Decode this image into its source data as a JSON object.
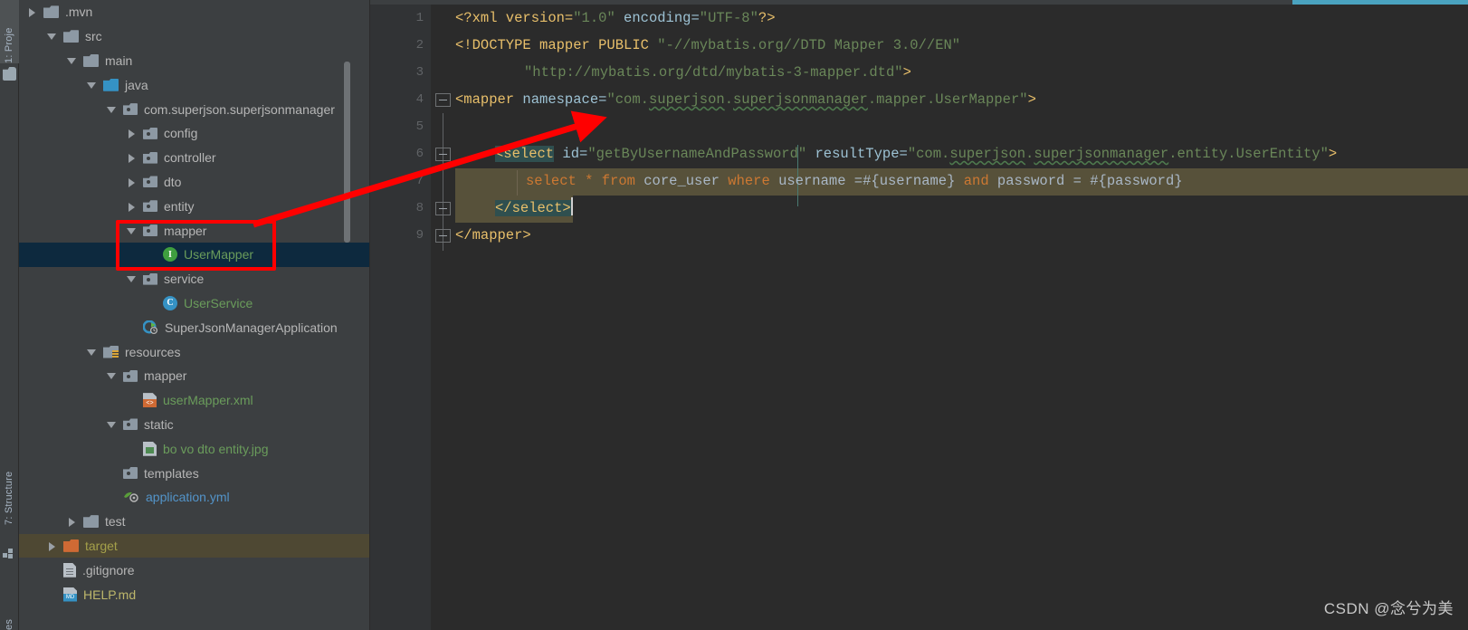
{
  "tool_strip": {
    "project_label": "1: Proje",
    "structure_label": "7: Structure",
    "favorites_label": "es",
    "folder_icon": "folder-icon",
    "grid_icon": "grid-icon"
  },
  "sidebar": {
    "items": [
      {
        "indent": 0,
        "twisty": "right",
        "icon": "folder",
        "label": ".mvn",
        "color": "c-grey",
        "row": ""
      },
      {
        "indent": 1,
        "twisty": "down",
        "icon": "folder",
        "label": "src",
        "color": "c-grey",
        "row": ""
      },
      {
        "indent": 2,
        "twisty": "down",
        "icon": "folder",
        "label": "main",
        "color": "c-grey",
        "row": ""
      },
      {
        "indent": 3,
        "twisty": "down",
        "icon": "folder-src",
        "label": "java",
        "color": "c-grey",
        "row": ""
      },
      {
        "indent": 4,
        "twisty": "down",
        "icon": "pkg",
        "label": "com.superjson.superjsonmanager",
        "color": "c-grey",
        "row": ""
      },
      {
        "indent": 5,
        "twisty": "right",
        "icon": "pkg",
        "label": "config",
        "color": "c-grey",
        "row": ""
      },
      {
        "indent": 5,
        "twisty": "right",
        "icon": "pkg",
        "label": "controller",
        "color": "c-grey",
        "row": ""
      },
      {
        "indent": 5,
        "twisty": "right",
        "icon": "pkg",
        "label": "dto",
        "color": "c-grey",
        "row": ""
      },
      {
        "indent": 5,
        "twisty": "right",
        "icon": "pkg",
        "label": "entity",
        "color": "c-grey",
        "row": ""
      },
      {
        "indent": 5,
        "twisty": "down",
        "icon": "pkg",
        "label": "mapper",
        "color": "c-grey",
        "row": ""
      },
      {
        "indent": 6,
        "twisty": "none",
        "icon": "iface",
        "label": "UserMapper",
        "color": "c-green",
        "row": "sel-blue"
      },
      {
        "indent": 5,
        "twisty": "down",
        "icon": "pkg",
        "label": "service",
        "color": "c-grey",
        "row": ""
      },
      {
        "indent": 6,
        "twisty": "none",
        "icon": "class",
        "label": "UserService",
        "color": "c-green",
        "row": ""
      },
      {
        "indent": 5,
        "twisty": "none",
        "icon": "spring",
        "label": "SuperJsonManagerApplication",
        "color": "c-grey",
        "row": ""
      },
      {
        "indent": 3,
        "twisty": "down",
        "icon": "res",
        "label": "resources",
        "color": "c-grey",
        "row": ""
      },
      {
        "indent": 4,
        "twisty": "down",
        "icon": "pkg",
        "label": "mapper",
        "color": "c-grey",
        "row": ""
      },
      {
        "indent": 5,
        "twisty": "none",
        "icon": "xml",
        "label": "userMapper.xml",
        "color": "c-green",
        "row": ""
      },
      {
        "indent": 4,
        "twisty": "down",
        "icon": "pkg",
        "label": "static",
        "color": "c-grey",
        "row": ""
      },
      {
        "indent": 5,
        "twisty": "none",
        "icon": "img",
        "label": "bo vo dto entity.jpg",
        "color": "c-green",
        "row": ""
      },
      {
        "indent": 4,
        "twisty": "none",
        "icon": "pkg",
        "label": "templates",
        "color": "c-grey",
        "row": ""
      },
      {
        "indent": 4,
        "twisty": "none",
        "icon": "yml",
        "label": "application.yml",
        "color": "c-blue",
        "row": ""
      },
      {
        "indent": 2,
        "twisty": "right",
        "icon": "folder",
        "label": "test",
        "color": "c-grey",
        "row": ""
      },
      {
        "indent": 1,
        "twisty": "right",
        "icon": "folder-target",
        "label": "target",
        "color": "c-tgt",
        "row": "sel-olive"
      },
      {
        "indent": 1,
        "twisty": "none",
        "icon": "file",
        "label": ".gitignore",
        "color": "c-grey",
        "row": ""
      },
      {
        "indent": 1,
        "twisty": "none",
        "icon": "md",
        "label": "HELP.md",
        "color": "c-olive",
        "row": ""
      }
    ]
  },
  "editor": {
    "line_numbers": [
      "1",
      "2",
      "3",
      "4",
      "5",
      "6",
      "7",
      "8",
      "9"
    ],
    "code": {
      "l1_a": "<?xml version=",
      "l1_b": "\"1.0\"",
      "l1_c": " encoding=",
      "l1_d": "\"UTF-8\"",
      "l1_e": "?>",
      "l2_a": "<!DOCTYPE mapper PUBLIC ",
      "l2_b": "\"-//mybatis.org//DTD Mapper 3.0//EN\"",
      "l3_a": "\"http://mybatis.org/dtd/mybatis-3-mapper.dtd\"",
      "l3_b": ">",
      "l4_a": "<mapper",
      "l4_b": " namespace=",
      "l4_c": "\"com.",
      "l4_d": "superjson",
      "l4_e": ".",
      "l4_f": "superjsonmanager",
      "l4_g": ".mapper.UserMapper\"",
      "l4_h": ">",
      "l6_a": "<select",
      "l6_b": " id=",
      "l6_c": "\"getByUsernameAndPassword\"",
      "l6_d": " resultType=",
      "l6_e": "\"com.",
      "l6_f": "superjson",
      "l6_g": ".",
      "l6_h": "superjsonmanager",
      "l6_i": ".entity.UserEntity\"",
      "l6_j": ">",
      "l7_a": "select",
      "l7_b": " * ",
      "l7_c": "from",
      "l7_d": " core_user ",
      "l7_e": "where",
      "l7_f": " username =#{username} ",
      "l7_g": "and",
      "l7_h": " password = #{password}",
      "l8_a": "</select>",
      "l9_a": "</mapper>"
    },
    "scrollbar": {
      "accent_color": "#4aa3c0"
    }
  },
  "annotation": {
    "highlight_box_name": "red-rectangle-around-usermapper",
    "arrow_name": "red-arrow-pointing-to-select-tag",
    "color": "#ff0000"
  },
  "watermark": {
    "text": "CSDN @念兮为美"
  }
}
